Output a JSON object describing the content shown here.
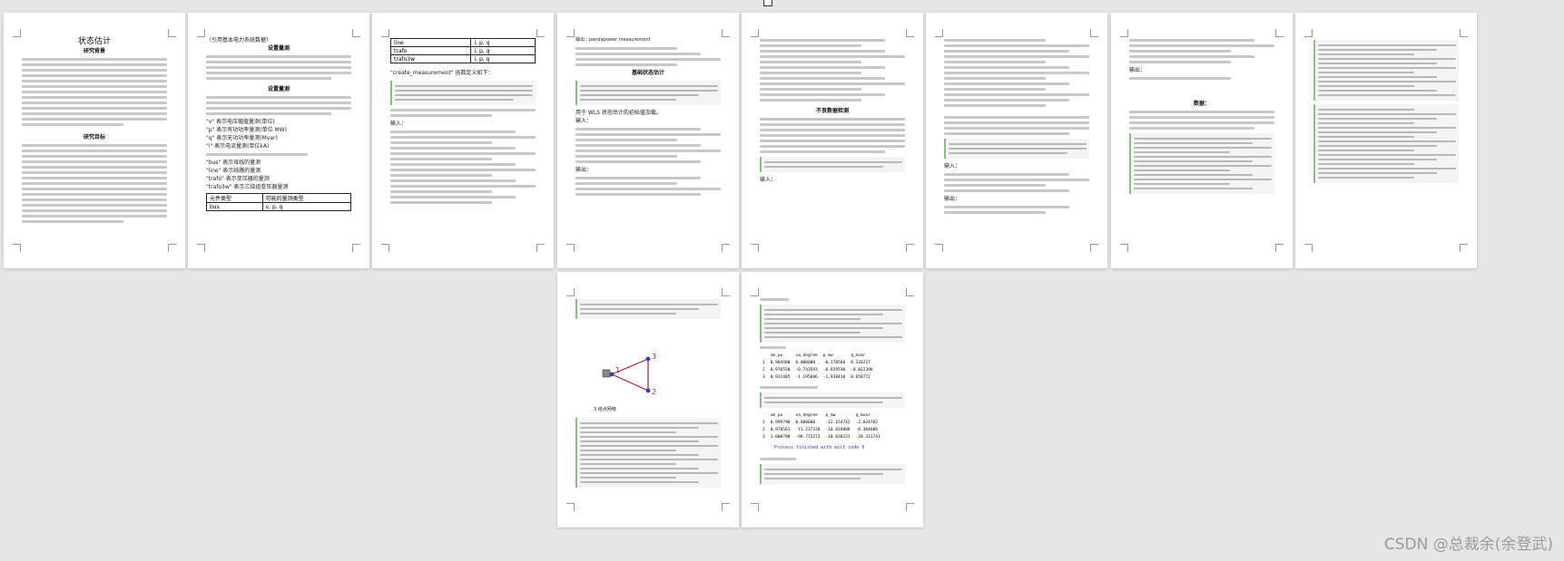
{
  "viewer": {
    "watermark": "CSDN @总裁余(余登武)"
  },
  "pages": [
    {
      "id": 1,
      "title": "状态估计",
      "heading1": "研究背景",
      "heading2": "研究目标",
      "lines_a": [
        "状态估计是能量管理系统中的核心环节，其主要功能是根据SCADA系统",
        "采集的实时量测数据，计算出电力系统当前运行状态的最优估计值。"
      ],
      "lines_b": [
        "为了提高数据质量，需要进行不良数据检测与辨识，本文基于pandapower",
        "进行分析。"
      ]
    },
    {
      "id": 2,
      "head": "（引用基本电力系统数据）",
      "heading": "设置量测",
      "bullets": [
        "\"v\" 表示电压幅值量测(单位)",
        "\"p\" 表示有功功率量测(单位 MW)",
        "\"q\" 表示无功功率量测(Mvar)",
        "\"i\" 表示电流量测(单位kA)",
        "\"bus\" 表示母线的量测",
        "\"line\" 表示线路的量测",
        "\"trafo\" 表示变压器的量测",
        "\"trafo3w\" 表示三绕组变压器量测"
      ],
      "table": [
        [
          "元件类型",
          "可能的量测类型"
        ],
        [
          "bus",
          "v, p, q"
        ]
      ]
    },
    {
      "id": 3,
      "table": [
        [
          "line",
          "i, p, q"
        ],
        [
          "trafo",
          "i, p, q"
        ],
        [
          "trafo3w",
          "i, p, q"
        ]
      ],
      "func": "\"create_measurement\" 函数定义如下：",
      "label": "输入："
    },
    {
      "id": 4,
      "top": "输出：pandapower measurement",
      "heading": "基础状态估计",
      "label1": "输入：",
      "label2": "输出：",
      "note": "用于 WLS 状态估计的初始值加载。"
    },
    {
      "id": 5,
      "heading": "不良数据检测",
      "label": "输入："
    },
    {
      "id": 6,
      "note": "输入：",
      "label": "输出："
    },
    {
      "id": 7,
      "label": "输出：",
      "heading": "数据："
    },
    {
      "id": 8
    },
    {
      "id": 9,
      "caption": "3 结点网络"
    },
    {
      "id": 10,
      "table1": {
        "header": [
          "vm_pu",
          "va_degree",
          "p_mw",
          "q_mvar"
        ],
        "rows": [
          [
            "1",
            "0.984480",
            "0.000000",
            "-0.170560",
            "0.326217"
          ],
          [
            "2",
            "0.976550",
            "-0.743593",
            "-0.659530",
            "-0.022396"
          ],
          [
            "3",
            "0.931405",
            "-1.195686",
            "-1.938410",
            "0.650772"
          ]
        ]
      },
      "table2": {
        "header": [
          "vm_pu",
          "va_degree",
          "p_mw",
          "q_mvar"
        ],
        "rows": [
          [
            "1",
            "0.999790",
            "0.000000",
            "-12.154742",
            "-2.034702"
          ],
          [
            "2",
            "0.978561",
            "-11.237228",
            "-10.818888",
            "-0.304686"
          ],
          [
            "3",
            "1.000798",
            "-98.772273",
            "-10.630231",
            "-20.311743"
          ]
        ]
      },
      "finish": "Process finished with exit code 0"
    }
  ],
  "diagram": {
    "nodes": [
      "1",
      "2",
      "3"
    ],
    "node_color": "#2a3fb8",
    "line_color": "#c0182a"
  }
}
